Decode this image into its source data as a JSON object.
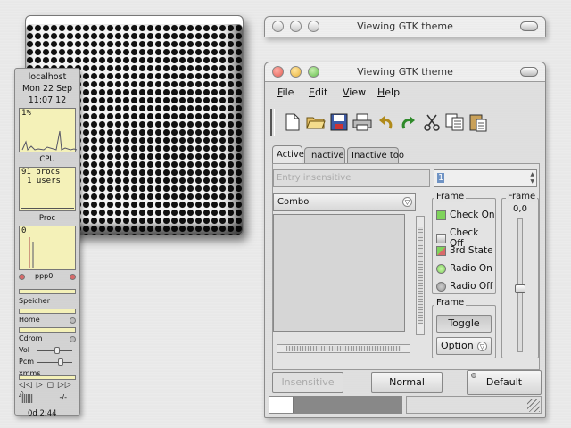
{
  "gkrellm": {
    "host": "localhost",
    "date": "Mon 22 Sep",
    "time": "11:07 12",
    "cpu_value": "1%",
    "cpu_label": "CPU",
    "proc_line1": "91 procs",
    "proc_line2": "1 users",
    "proc_label": "Proc",
    "net_value": "0",
    "net_label": "ppp0",
    "mem_label": "Speicher",
    "home_label": "Home",
    "cdrom_label": "Cdrom",
    "vol_label": "Vol",
    "pcm_label": "Pcm",
    "xmms_label": "xmms",
    "xmms_pos": "-/-",
    "uptime": "0d  2:44"
  },
  "window_back": {
    "title": "Viewing GTK theme"
  },
  "window_main": {
    "title": "Viewing GTK theme",
    "menu": [
      "File",
      "Edit",
      "View",
      "Help"
    ],
    "toolbar_icons": [
      "new-file-icon",
      "open-folder-icon",
      "save-icon",
      "print-icon",
      "undo-icon",
      "redo-icon",
      "cut-icon",
      "copy-icon",
      "paste-icon"
    ],
    "tabs": [
      "Active",
      "Inactive",
      "Inactive too"
    ],
    "entry_placeholder": "Entry insensitive",
    "spin_value": "1",
    "combo_value": "Combo",
    "frame1_title": "Frame",
    "check_on": "Check On",
    "check_off": "Check Off",
    "third_state": "3rd State",
    "radio_on": "Radio On",
    "radio_off": "Radio Off",
    "frame2_title": "Frame",
    "toggle_label": "Toggle",
    "option_label": "Option",
    "frame3_title": "Frame",
    "scale_value": "0,0",
    "btn_insensitive": "Insensitive",
    "btn_normal": "Normal",
    "btn_default": "Default",
    "progress": 0.18
  },
  "colors": {
    "gkrellm_panel": "#f4f1b8",
    "close": "#e25c52",
    "minimize": "#e8b13a",
    "zoom": "#62bd4b",
    "check_green": "#7fd35c",
    "selection": "#6f93c4"
  }
}
